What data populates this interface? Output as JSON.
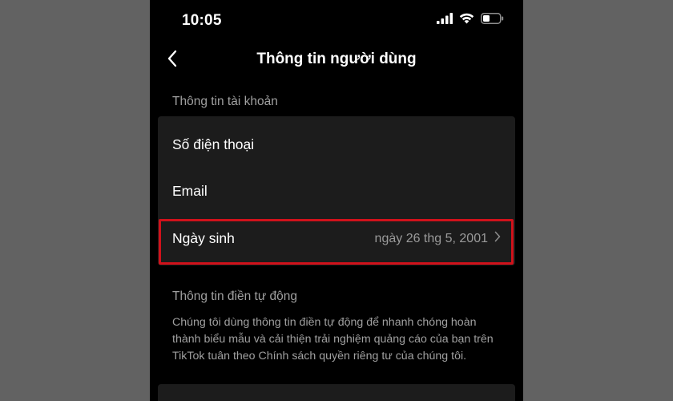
{
  "status_bar": {
    "time": "10:05",
    "icons": [
      "signal-icon",
      "wifi-icon",
      "battery-icon"
    ]
  },
  "nav": {
    "title": "Thông tin người dùng",
    "back_icon": "chevron-left-icon"
  },
  "account_section": {
    "label": "Thông tin tài khoản",
    "items": [
      {
        "label": "Số điện thoại",
        "value": ""
      },
      {
        "label": "Email",
        "value": ""
      },
      {
        "label": "Ngày sinh",
        "value": "ngày 26 thg 5, 2001",
        "highlighted": true
      }
    ]
  },
  "autofill_section": {
    "label": "Thông tin điền tự động",
    "description_before": "Chúng tôi dùng thông tin điền tự động để nhanh chóng hoàn thành biểu mẫu và cải thiện trải nghiệm quảng cáo của bạn trên TikTok tuân theo ",
    "policy_link": "Chính sách quyền riêng tư",
    "description_after": " của chúng tôi."
  },
  "colors": {
    "background": "#000000",
    "card": "#1c1c1c",
    "highlight": "#d0121b",
    "muted_text": "#a0a0a0"
  }
}
